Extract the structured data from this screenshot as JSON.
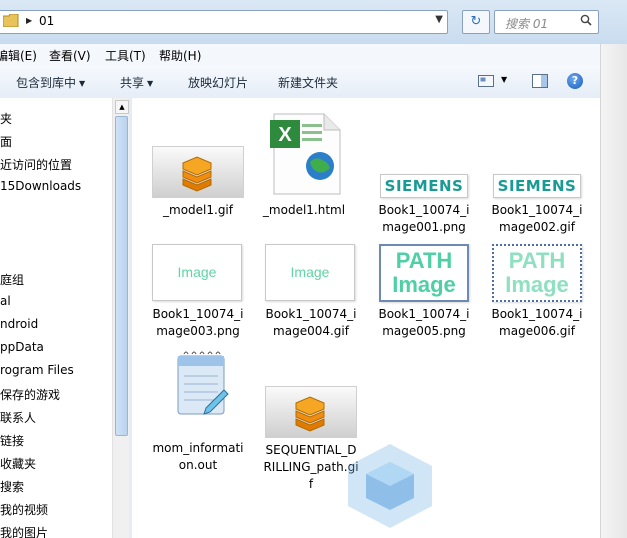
{
  "address": {
    "path": "01"
  },
  "search": {
    "placeholder": "搜索 01"
  },
  "menu": {
    "edit": "编辑(E)",
    "view": "查看(V)",
    "tools": "工具(T)",
    "help": "帮助(H)"
  },
  "commands": {
    "include_library": "包含到库中",
    "share": "共享",
    "slideshow": "放映幻灯片",
    "new_folder": "新建文件夹"
  },
  "nav": [
    "夹",
    "面",
    "近访问的位置",
    "15Downloads",
    "",
    "",
    "庭组",
    "al",
    "ndroid",
    "ppData",
    "rogram Files",
    "保存的游戏",
    "联系人",
    "链接",
    "收藏夹",
    "搜索",
    "我的视频",
    "我的图片"
  ],
  "files": [
    {
      "name": "_model1.gif",
      "kind": "model"
    },
    {
      "name": "_model1.html",
      "kind": "excel"
    },
    {
      "name": "Book1_10074_image001.png",
      "kind": "siemens",
      "text": "SIEMENS"
    },
    {
      "name": "Book1_10074_image002.gif",
      "kind": "siemens",
      "text": "SIEMENS"
    },
    {
      "name": "Book1_10074_image003.png",
      "kind": "image",
      "text": "Image"
    },
    {
      "name": "Book1_10074_image004.gif",
      "kind": "image",
      "text": "Image"
    },
    {
      "name": "Book1_10074_image005.png",
      "kind": "path",
      "text": "PATH Image"
    },
    {
      "name": "Book1_10074_image006.gif",
      "kind": "path",
      "text": "PATH Image"
    },
    {
      "name": "mom_information.out",
      "kind": "notepad"
    },
    {
      "name": "SEQUENTIAL_DRILLING_path.gif",
      "kind": "model"
    }
  ],
  "labels": {
    "f0": [
      "_model1.gif"
    ],
    "f1": [
      "_model1.html"
    ],
    "f2": [
      "Book1_10074_i",
      "mage001.png"
    ],
    "f3": [
      "Book1_10074_i",
      "mage002.gif"
    ],
    "f4": [
      "Book1_10074_i",
      "mage003.png"
    ],
    "f5": [
      "Book1_10074_i",
      "mage004.gif"
    ],
    "f6": [
      "Book1_10074_i",
      "mage005.png"
    ],
    "f7": [
      "Book1_10074_i",
      "mage006.gif"
    ],
    "f8": [
      "mom_informati",
      "on.out"
    ],
    "f9": [
      "SEQUENTIAL_D",
      "RILLING_path.gi",
      "f"
    ]
  },
  "thumb_text": {
    "siemens": "SIEMENS",
    "image": "Image",
    "path_line1": "PATH",
    "path_line2": "Image"
  },
  "colors": {
    "accent": "#1a9a94",
    "toolbar": "#e5edf7",
    "selection_border": "#2b6fc1"
  }
}
